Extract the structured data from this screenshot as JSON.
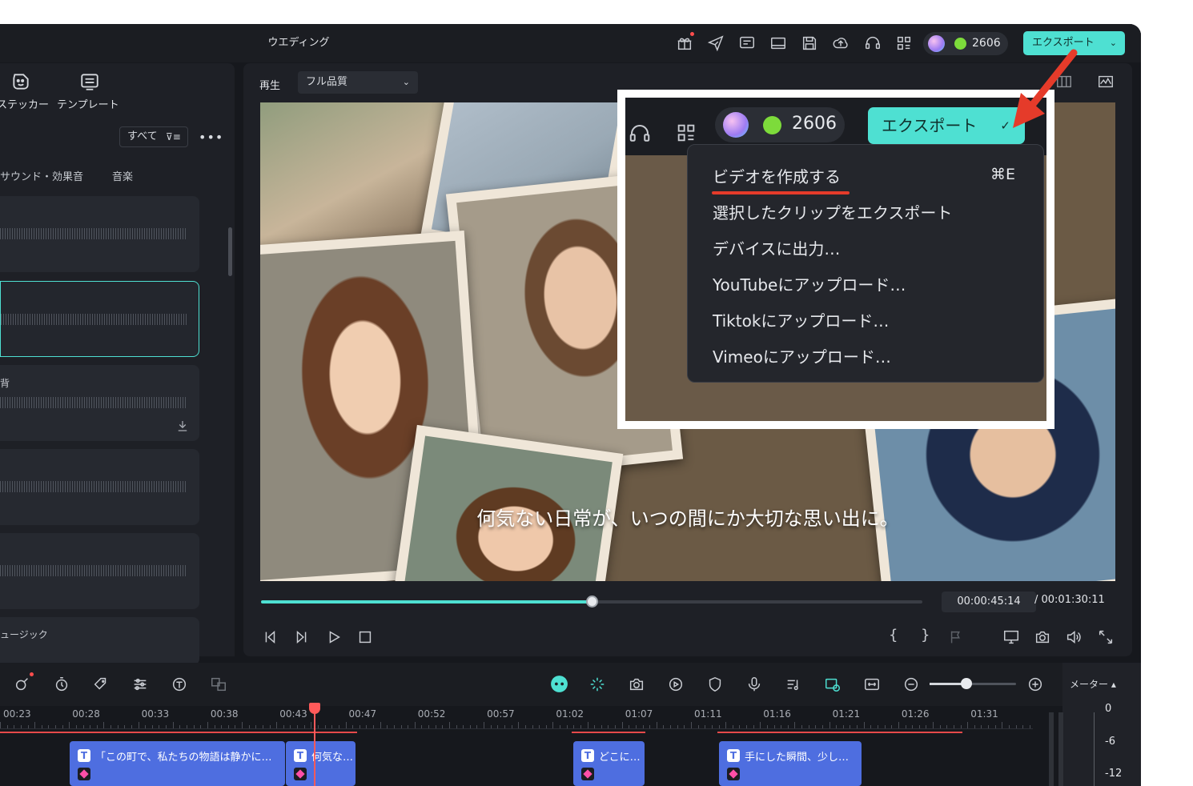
{
  "titlebar": {
    "title": "ウエディング",
    "credits": "2606",
    "export_label": "エクスポート"
  },
  "left_panel": {
    "tabs": [
      {
        "label": "ステッカー",
        "icon": "sticker-icon"
      },
      {
        "label": "テンプレート",
        "icon": "template-icon"
      }
    ],
    "filter_label": "すべて",
    "categories": [
      "サウンド・効果音",
      "音楽"
    ],
    "cards": [
      {
        "title": ""
      },
      {
        "title": ""
      },
      {
        "title": "背"
      },
      {
        "title": ""
      },
      {
        "title": ""
      }
    ],
    "bottom_label": "ュージック"
  },
  "preview": {
    "play_label": "再生",
    "quality": "フル品質",
    "subtitle": "何気ない日常が、いつの間にか大切な思い出に。",
    "current_time": "00:00:45:14",
    "total_time": "/ 00:01:30:11",
    "progress_fraction": 0.5
  },
  "timeline": {
    "meter_label": "メーター",
    "ticks": [
      "00:23",
      "00:28",
      "00:33",
      "00:38",
      "00:43",
      "00:47",
      "00:52",
      "00:57",
      "01:02",
      "01:07",
      "01:11",
      "01:16",
      "01:21",
      "01:26",
      "01:31"
    ],
    "clips": [
      {
        "label": "「この町で、私たちの物語は静かに…"
      },
      {
        "label": "何気な…"
      },
      {
        "label": "どこに…"
      },
      {
        "label": "手にした瞬間、少し…"
      }
    ],
    "meter_scale": [
      "0",
      "-6",
      "-12"
    ]
  },
  "callout": {
    "credits": "2606",
    "export_label": "エクスポート",
    "menu": [
      {
        "label": "ビデオを作成する",
        "shortcut": "⌘E"
      },
      {
        "label": "選択したクリップをエクスポート"
      },
      {
        "label": "デバイスに出力…"
      },
      {
        "label": "YouTubeにアップロード…"
      },
      {
        "label": "Tiktokにアップロード…"
      },
      {
        "label": "Vimeoにアップロード…"
      }
    ]
  },
  "colors": {
    "accent": "#4ee0d2",
    "annotation_red": "#e53b2a",
    "clip_blue": "#4e6ee0",
    "playhead": "#ff5a5a"
  }
}
